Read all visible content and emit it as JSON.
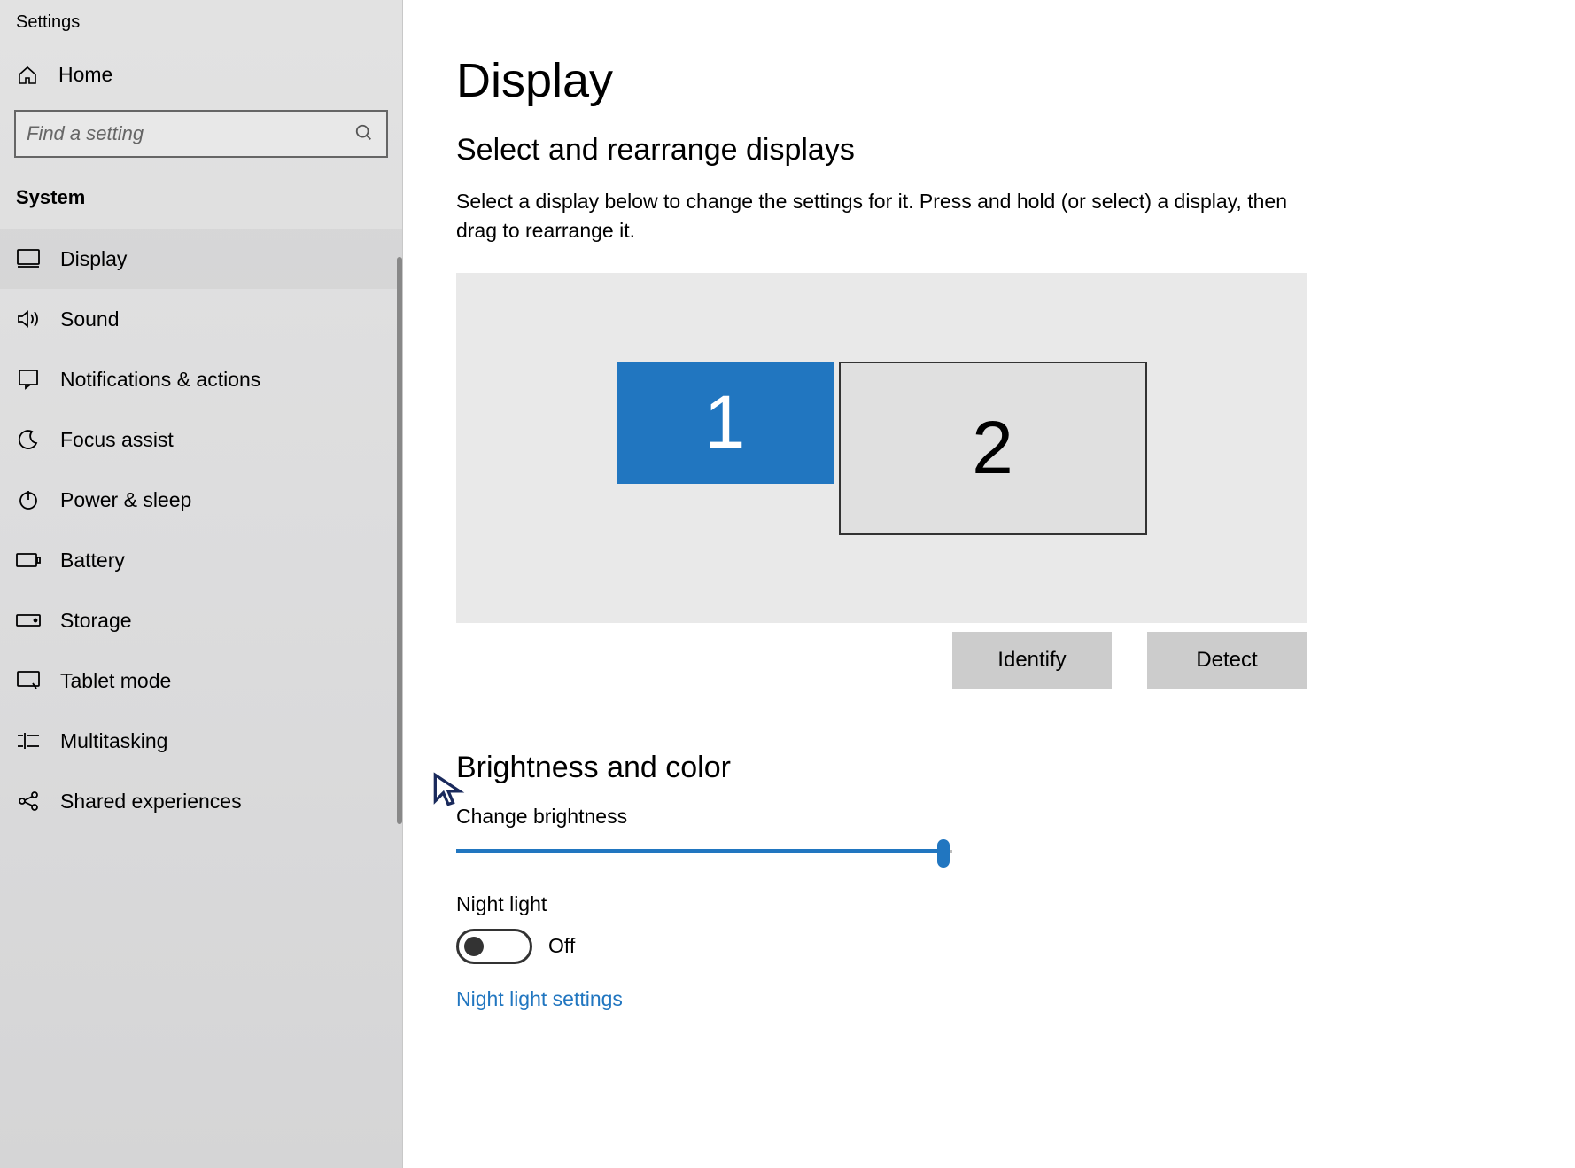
{
  "app_title": "Settings",
  "sidebar": {
    "home_label": "Home",
    "search_placeholder": "Find a setting",
    "section_header": "System",
    "items": [
      {
        "label": "Display",
        "icon": "monitor-icon"
      },
      {
        "label": "Sound",
        "icon": "speaker-icon"
      },
      {
        "label": "Notifications & actions",
        "icon": "notification-box-icon"
      },
      {
        "label": "Focus assist",
        "icon": "moon-icon"
      },
      {
        "label": "Power & sleep",
        "icon": "power-icon"
      },
      {
        "label": "Battery",
        "icon": "battery-icon"
      },
      {
        "label": "Storage",
        "icon": "drive-icon"
      },
      {
        "label": "Tablet mode",
        "icon": "tablet-icon"
      },
      {
        "label": "Multitasking",
        "icon": "multitask-icon"
      },
      {
        "label": "Shared experiences",
        "icon": "share-icon"
      }
    ]
  },
  "main": {
    "title": "Display",
    "arrange": {
      "heading": "Select and rearrange displays",
      "description": "Select a display below to change the settings for it. Press and hold (or select) a display, then drag to rearrange it.",
      "monitors": {
        "primary": "1",
        "secondary": "2"
      },
      "identify_label": "Identify",
      "detect_label": "Detect"
    },
    "brightness": {
      "heading": "Brightness and color",
      "change_label": "Change brightness",
      "slider_value_pct": 98,
      "night_light_label": "Night light",
      "night_light_state": "Off",
      "night_light_link": "Night light settings"
    }
  }
}
